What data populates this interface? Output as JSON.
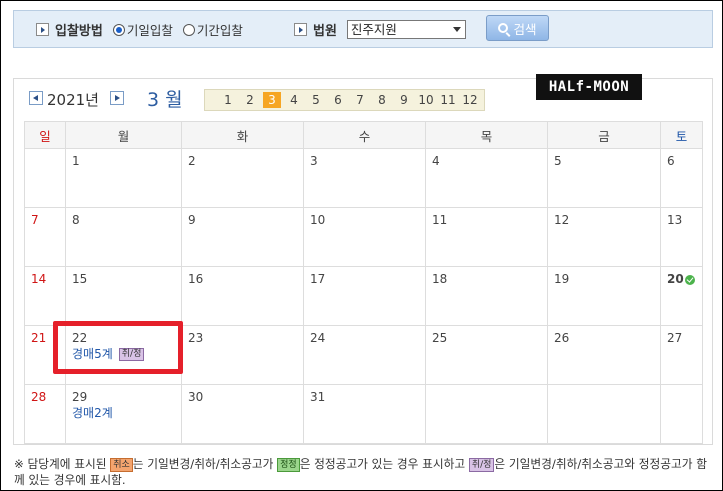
{
  "search": {
    "method_label": "입찰방법",
    "radio_options": [
      {
        "label": "기일입찰",
        "selected": true
      },
      {
        "label": "기간입찰",
        "selected": false
      }
    ],
    "court_label": "법원",
    "court_value": "진주지원",
    "button_label": "검색"
  },
  "calendar": {
    "year_label": "2021년",
    "month_label": "3 월",
    "months": [
      "1",
      "2",
      "3",
      "4",
      "5",
      "6",
      "7",
      "8",
      "9",
      "10",
      "11",
      "12"
    ],
    "active_month": "3",
    "logo_text": "HALf-MOON",
    "weekdays": [
      "일",
      "월",
      "화",
      "수",
      "목",
      "금",
      "토"
    ],
    "weeks": [
      [
        {
          "day": ""
        },
        {
          "day": "1"
        },
        {
          "day": "2"
        },
        {
          "day": "3"
        },
        {
          "day": "4"
        },
        {
          "day": "5"
        },
        {
          "day": "6"
        }
      ],
      [
        {
          "day": "7"
        },
        {
          "day": "8"
        },
        {
          "day": "9"
        },
        {
          "day": "10"
        },
        {
          "day": "11"
        },
        {
          "day": "12"
        },
        {
          "day": "13"
        }
      ],
      [
        {
          "day": "14"
        },
        {
          "day": "15"
        },
        {
          "day": "16"
        },
        {
          "day": "17"
        },
        {
          "day": "18"
        },
        {
          "day": "19"
        },
        {
          "day": "20"
        }
      ],
      [
        {
          "day": "21"
        },
        {
          "day": "22",
          "link": "경매5계",
          "badge": "취/정"
        },
        {
          "day": "23"
        },
        {
          "day": "24"
        },
        {
          "day": "25"
        },
        {
          "day": "26"
        },
        {
          "day": "27"
        }
      ],
      [
        {
          "day": "28"
        },
        {
          "day": "29",
          "link": "경매2계"
        },
        {
          "day": "30"
        },
        {
          "day": "31"
        },
        {
          "day": ""
        },
        {
          "day": ""
        },
        {
          "day": ""
        }
      ]
    ]
  },
  "legend": {
    "prefix": "※ 담당계에 표시된",
    "badge_cancel": "취소",
    "text1": "는 기일변경/취하/취소공고가",
    "badge_fix": "정정",
    "text2": "은 정정공고가 있는 경우 표시하고",
    "badge_both": "취/정",
    "text3": "은 기일변경/취하/취소공고와 정정공고가 함께 있는 경우에 표시함."
  },
  "colors": {
    "sunday": "#d01515",
    "saturday": "#2157a9",
    "active_month": "#f6a623",
    "highlight": "#e5202a"
  }
}
